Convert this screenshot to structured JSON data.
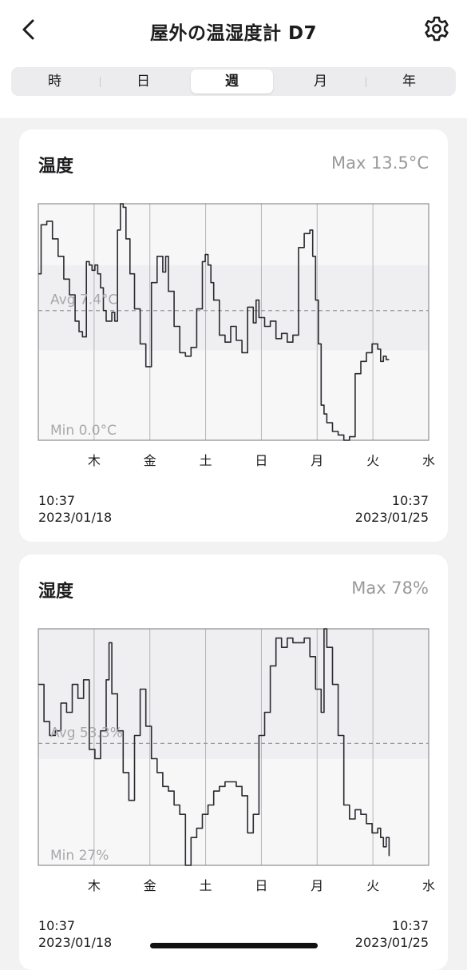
{
  "header": {
    "title": "屋外の温湿度計 D7",
    "back_icon": "chevron-left-icon",
    "settings_icon": "gear-icon"
  },
  "tabs": [
    {
      "label": "時",
      "active": false
    },
    {
      "label": "日",
      "active": false
    },
    {
      "label": "週",
      "active": true
    },
    {
      "label": "月",
      "active": false
    },
    {
      "label": "年",
      "active": false
    }
  ],
  "temperature_card": {
    "title": "温度",
    "max": "Max 13.5°C",
    "avg": "Avg 7.4°C",
    "min": "Min 0.0°C",
    "start_time": "10:37",
    "start_date": "2023/01/18",
    "end_time": "10:37",
    "end_date": "2023/01/25"
  },
  "humidity_card": {
    "title": "湿度",
    "max": "Max 78%",
    "avg": "Avg 53.3%",
    "min": "Min 27%",
    "start_time": "10:37",
    "start_date": "2023/01/18",
    "end_time": "10:37",
    "end_date": "2023/01/25"
  },
  "chart_data": [
    {
      "type": "line",
      "title": "温度",
      "categories": [
        "木",
        "金",
        "土",
        "日",
        "月",
        "火",
        "水"
      ],
      "ylim": [
        0.0,
        13.5
      ],
      "avg": 7.4,
      "x": [
        0,
        0.05,
        0.15,
        0.25,
        0.35,
        0.45,
        0.55,
        0.65,
        0.72,
        0.78,
        0.85,
        0.9,
        0.95,
        1.0,
        1.05,
        1.1,
        1.15,
        1.2,
        1.3,
        1.35,
        1.4,
        1.45,
        1.5,
        1.55,
        1.62,
        1.7,
        1.8,
        1.9,
        2.0,
        2.1,
        2.2,
        2.25,
        2.3,
        2.4,
        2.5,
        2.6,
        2.7,
        2.8,
        2.9,
        2.95,
        3.0,
        3.05,
        3.1,
        3.2,
        3.3,
        3.4,
        3.5,
        3.6,
        3.7,
        3.8,
        3.85,
        3.9,
        4.0,
        4.1,
        4.2,
        4.3,
        4.4,
        4.5,
        4.6,
        4.7,
        4.8,
        4.85,
        4.9,
        4.95,
        5.0,
        5.05,
        5.1,
        5.2,
        5.3,
        5.4,
        5.5,
        5.6,
        5.7,
        5.8,
        5.9,
        6.0,
        6.05,
        6.1,
        6.15,
        6.2
      ],
      "values": [
        9.5,
        12.3,
        12.5,
        11.5,
        10.5,
        9.2,
        8.3,
        6.8,
        6.2,
        5.9,
        10.2,
        10.0,
        9.7,
        10.0,
        9.5,
        8.7,
        7.4,
        6.8,
        7.3,
        6.8,
        12.0,
        13.5,
        13.3,
        11.5,
        9.5,
        7.5,
        5.5,
        4.2,
        9.0,
        10.5,
        9.6,
        10.5,
        8.5,
        6.5,
        5.0,
        4.8,
        5.3,
        7.5,
        10.2,
        10.6,
        10.0,
        9.0,
        8.0,
        6.0,
        5.6,
        6.5,
        5.7,
        5.0,
        7.6,
        6.7,
        8.0,
        7.0,
        6.5,
        6.8,
        5.8,
        6.1,
        5.6,
        6.0,
        11.0,
        11.8,
        12.0,
        10.5,
        8.0,
        5.5,
        2.0,
        1.5,
        1.0,
        0.5,
        0.3,
        0.0,
        0.2,
        3.8,
        4.5,
        5.0,
        5.5,
        5.2,
        4.5,
        4.8,
        4.6,
        4.6
      ]
    },
    {
      "type": "line",
      "title": "湿度",
      "categories": [
        "木",
        "金",
        "土",
        "日",
        "月",
        "火",
        "水"
      ],
      "ylim": [
        27,
        78
      ],
      "avg": 53.3,
      "x": [
        0,
        0.1,
        0.2,
        0.3,
        0.4,
        0.5,
        0.6,
        0.7,
        0.8,
        0.9,
        1.0,
        1.1,
        1.2,
        1.25,
        1.3,
        1.4,
        1.5,
        1.6,
        1.7,
        1.8,
        1.9,
        2.0,
        2.1,
        2.2,
        2.3,
        2.4,
        2.5,
        2.6,
        2.7,
        2.8,
        2.9,
        3.0,
        3.1,
        3.2,
        3.3,
        3.4,
        3.5,
        3.6,
        3.7,
        3.8,
        3.9,
        4.0,
        4.1,
        4.2,
        4.3,
        4.4,
        4.5,
        4.6,
        4.7,
        4.8,
        4.9,
        5.0,
        5.05,
        5.1,
        5.2,
        5.3,
        5.4,
        5.5,
        5.6,
        5.7,
        5.8,
        5.9,
        6.0,
        6.05,
        6.1,
        6.15,
        6.2
      ],
      "values": [
        66,
        58,
        55,
        56,
        62,
        60,
        66,
        63,
        67,
        52,
        50,
        56,
        67,
        75,
        64,
        56,
        47,
        41,
        55,
        65,
        57,
        50,
        47,
        44,
        43,
        40,
        38,
        27,
        33,
        35,
        38,
        40,
        43,
        44,
        45,
        45,
        44,
        42,
        34,
        38,
        55,
        60,
        70,
        76,
        74,
        76,
        75,
        75,
        76,
        72,
        65,
        60,
        78,
        74,
        66,
        55,
        40,
        37,
        39,
        38,
        36,
        34,
        35,
        33,
        31,
        33,
        29
      ]
    }
  ]
}
